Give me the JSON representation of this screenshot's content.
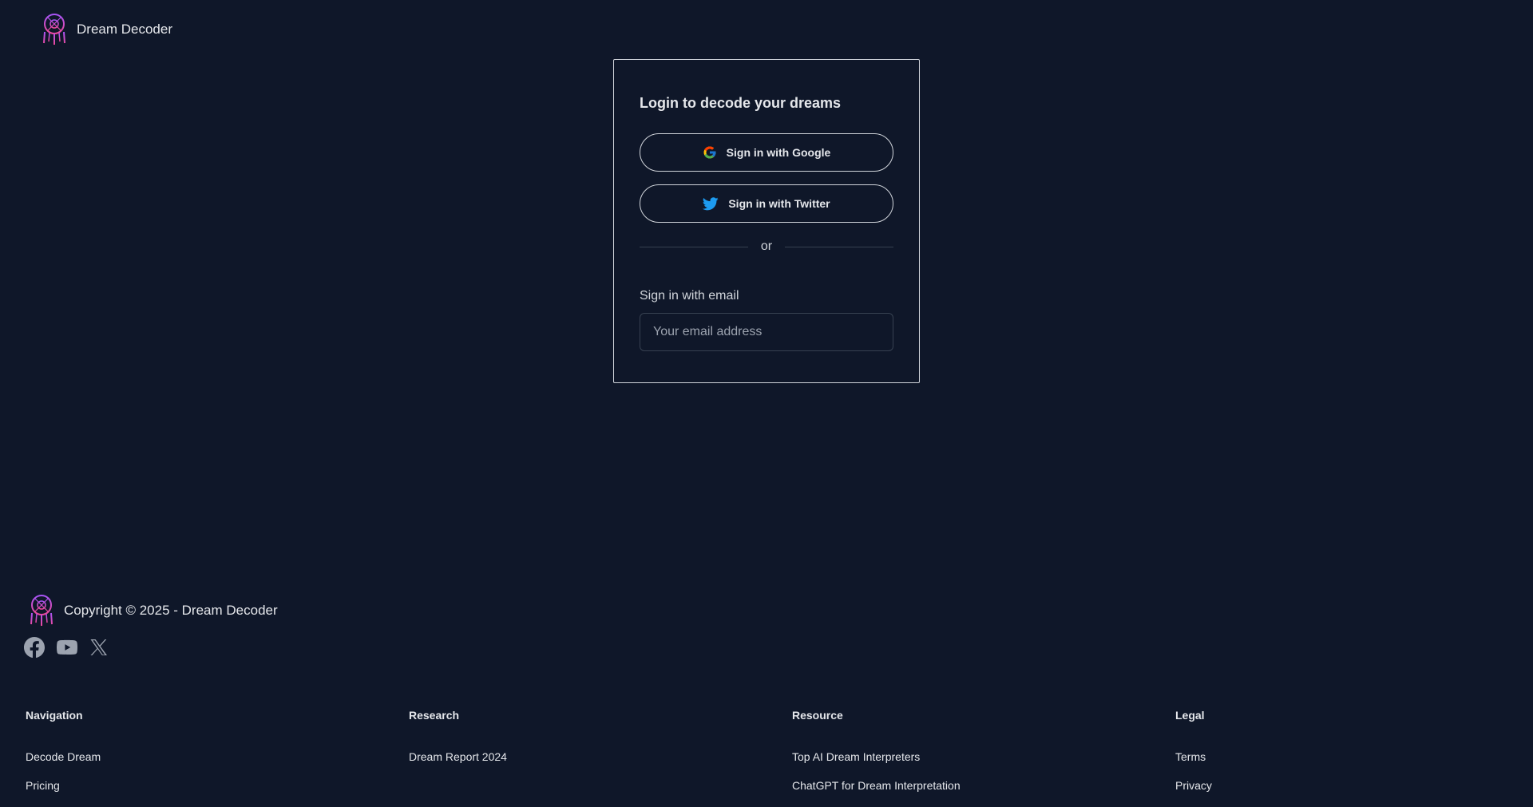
{
  "brand": {
    "name": "Dream Decoder",
    "icon": "dreamcatcher-logo-icon",
    "accent_colors": [
      "#a855f7",
      "#ec4899"
    ]
  },
  "login": {
    "title": "Login to decode your dreams",
    "google_label": "Sign in with Google",
    "twitter_label": "Sign in with Twitter",
    "divider_text": "or",
    "email_label": "Sign in with email",
    "email_placeholder": "Your email address",
    "email_value": ""
  },
  "footer": {
    "copyright": "Copyright © 2025 - Dream Decoder",
    "socials": [
      {
        "name": "facebook-icon"
      },
      {
        "name": "youtube-icon"
      },
      {
        "name": "x-icon"
      }
    ],
    "columns": [
      {
        "heading": "Navigation",
        "links": [
          "Decode Dream",
          "Pricing"
        ]
      },
      {
        "heading": "Research",
        "links": [
          "Dream Report 2024"
        ]
      },
      {
        "heading": "Resource",
        "links": [
          "Top AI Dream Interpreters",
          "ChatGPT for Dream Interpretation"
        ]
      },
      {
        "heading": "Legal",
        "links": [
          "Terms",
          "Privacy"
        ]
      }
    ]
  },
  "colors": {
    "background": "#0f1729",
    "text": "#e5e7eb",
    "border": "#d1d5db",
    "twitter_blue": "#1d9bf0"
  }
}
